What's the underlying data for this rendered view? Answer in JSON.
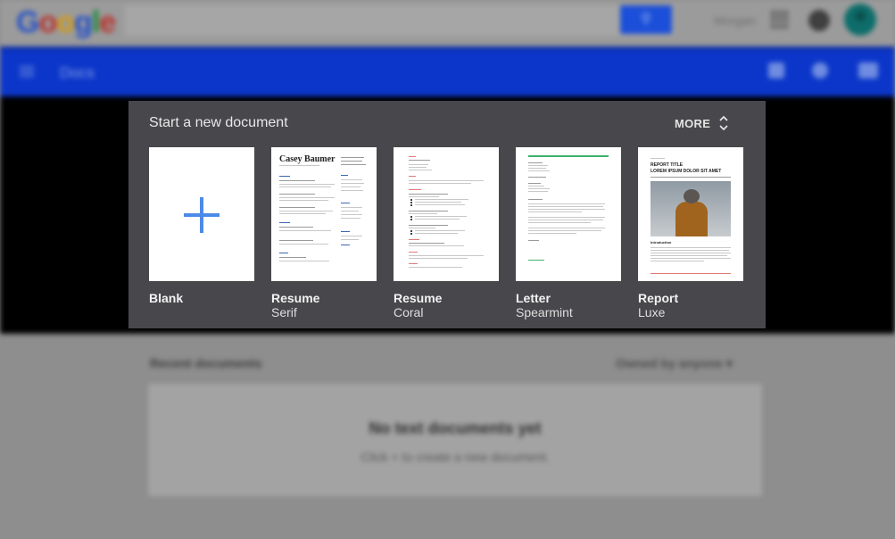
{
  "header": {
    "logo_letters": [
      {
        "ch": "G",
        "color": "#2450c8"
      },
      {
        "ch": "o",
        "color": "#b8332b"
      },
      {
        "ch": "o",
        "color": "#d29b14"
      },
      {
        "ch": "g",
        "color": "#2450c8"
      },
      {
        "ch": "l",
        "color": "#1f8a3b"
      },
      {
        "ch": "e",
        "color": "#b8332b"
      }
    ],
    "user_name": "Morgan"
  },
  "appbar": {
    "title": "Docs"
  },
  "gallery": {
    "title": "Start a new document",
    "more_label": "MORE",
    "templates": [
      {
        "name": "Blank",
        "subtitle": ""
      },
      {
        "name": "Resume",
        "subtitle": "Serif"
      },
      {
        "name": "Resume",
        "subtitle": "Coral"
      },
      {
        "name": "Letter",
        "subtitle": "Spearmint"
      },
      {
        "name": "Report",
        "subtitle": "Luxe"
      }
    ],
    "thumbnails": {
      "resume_serif_name": "Casey Baumer",
      "report_title": "REPORT TITLE",
      "report_subtitle": "LOREM IPSUM DOLOR SIT AMET",
      "report_intro": "Introduction"
    }
  },
  "recent": {
    "title": "Recent documents",
    "owner_filter": "Owned by anyone",
    "empty_title": "No text documents yet",
    "empty_hint": "Click + to create a new document."
  },
  "colors": {
    "accent_blue": "#4c8ae8",
    "appbar": "#0b36c9",
    "gallery_bg": "#48484c"
  }
}
